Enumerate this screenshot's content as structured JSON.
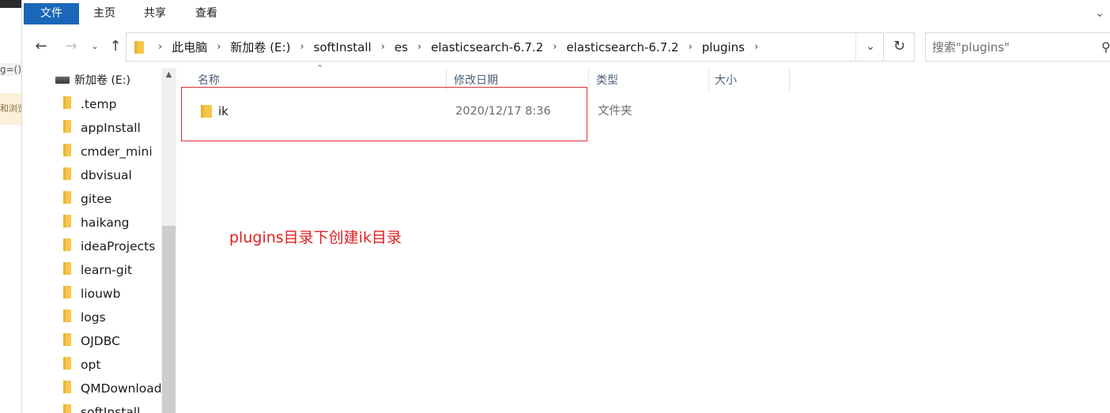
{
  "background": {
    "frag1": "g=()",
    "frag2": "和浏览"
  },
  "ribbon": {
    "file": "文件",
    "home": "主页",
    "share": "共享",
    "view": "查看"
  },
  "breadcrumb": [
    "此电脑",
    "新加卷 (E:)",
    "softInstall",
    "es",
    "elasticsearch-6.7.2",
    "elasticsearch-6.7.2",
    "plugins"
  ],
  "search": {
    "placeholder": "搜索\"plugins\""
  },
  "navpane": {
    "drive": "新加卷 (E:)",
    "folders": [
      ".temp",
      "appInstall",
      "cmder_mini",
      "dbvisual",
      "gitee",
      "haikang",
      "ideaProjects",
      "learn-git",
      "liouwb",
      "logs",
      "OJDBC",
      "opt",
      "QMDownload",
      "softInstall"
    ]
  },
  "columns": {
    "name": "名称",
    "modified": "修改日期",
    "type": "类型",
    "size": "大小"
  },
  "files": [
    {
      "name": "ik",
      "modified": "2020/12/17 8:36",
      "type": "文件夹",
      "size": ""
    }
  ],
  "annotation": "plugins目录下创建ik目录",
  "colors": {
    "accent": "#1a66b8",
    "folder": "#f6c64a",
    "annotation": "#e02020"
  },
  "icons": {
    "back": "arrow-left-icon",
    "forward": "arrow-right-icon",
    "up": "arrow-up-icon",
    "refresh": "refresh-icon",
    "search": "search-icon",
    "folder": "folder-icon",
    "drive": "drive-icon"
  }
}
